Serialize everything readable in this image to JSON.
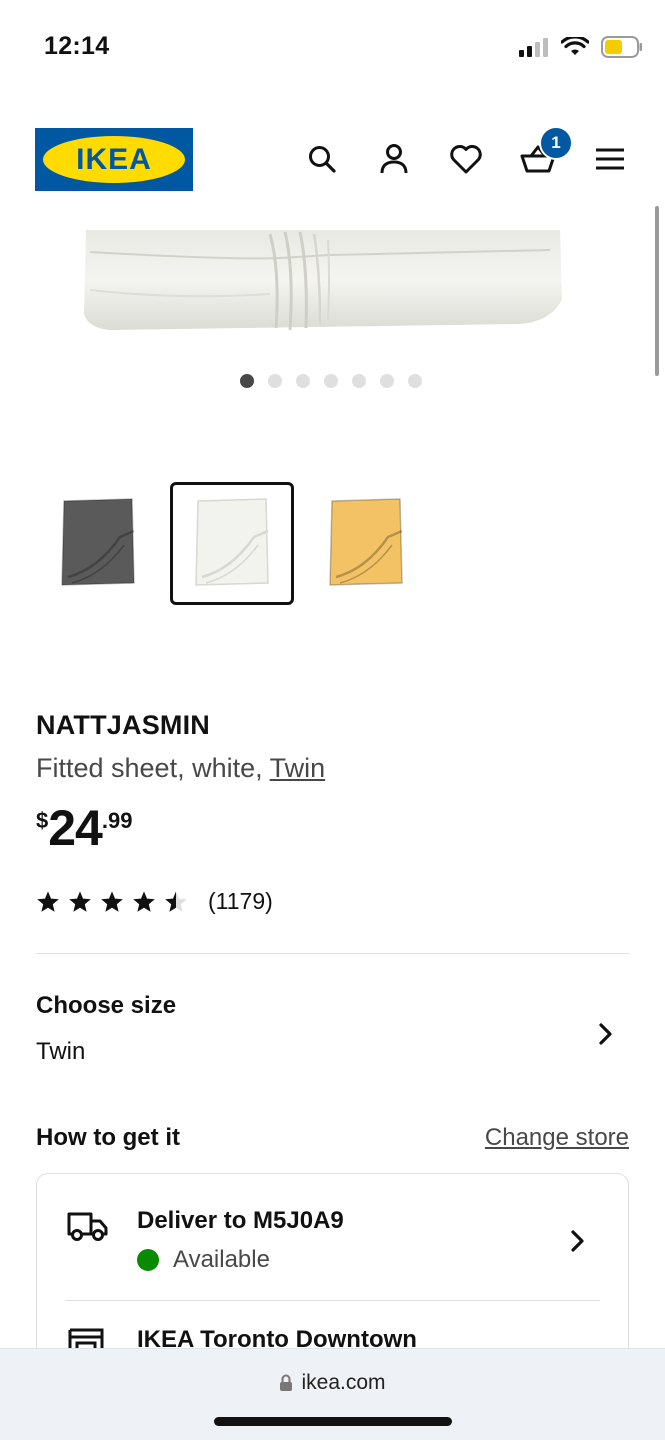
{
  "status_bar": {
    "time": "12:14"
  },
  "header": {
    "logo_text": "IKEA",
    "cart_count": "1",
    "brand_blue": "#0058a3",
    "brand_yellow": "#ffdb00"
  },
  "gallery": {
    "dot_count": 7,
    "active_dot": 1,
    "variants": [
      {
        "name": "dark-grey",
        "color": "#5a5a5a",
        "selected": false
      },
      {
        "name": "white",
        "color": "#f2f2ee",
        "selected": true
      },
      {
        "name": "yellow",
        "color": "#f3c265",
        "selected": false
      }
    ]
  },
  "product": {
    "name": "NATTJASMIN",
    "desc_prefix": "Fitted sheet, white, ",
    "desc_link": "Twin",
    "price_currency": "$",
    "price_int": "24",
    "price_dec": ".99",
    "rating": 4.5,
    "rating_count": "(1179)"
  },
  "size": {
    "label": "Choose size",
    "value": "Twin"
  },
  "fulfillment": {
    "title": "How to get it",
    "change_store": "Change store",
    "deliver_title": "Deliver to M5J0A9",
    "deliver_status": "Available",
    "store_title": "IKEA Toronto Downtown"
  },
  "browser": {
    "url": "ikea.com"
  }
}
